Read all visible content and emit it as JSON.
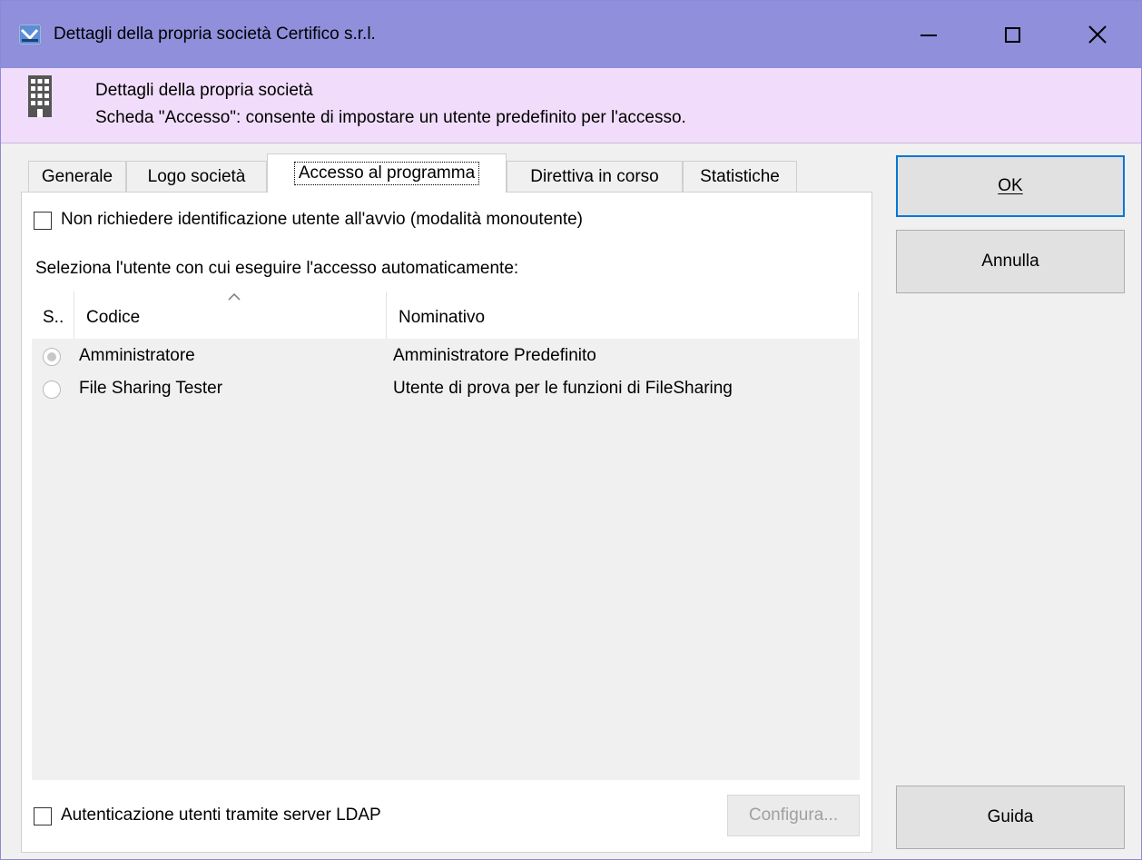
{
  "window": {
    "title": "Dettagli della propria società Certifico s.r.l.",
    "min_icon": "minimize-icon",
    "max_icon": "maximize-icon",
    "close_glyph": "✕"
  },
  "banner": {
    "title": "Dettagli della propria società",
    "description": "Scheda \"Accesso\": consente di impostare un utente predefinito per l'accesso.",
    "icon": "building-icon"
  },
  "tabs": [
    {
      "label": "Generale",
      "active": false
    },
    {
      "label": "Logo società",
      "active": false
    },
    {
      "label": "Accesso al programma",
      "active": true
    },
    {
      "label": "Direttiva in corso",
      "active": false
    },
    {
      "label": "Statistiche",
      "active": false
    }
  ],
  "access": {
    "single_user_label": "Non richiedere identificazione utente all'avvio (modalità monoutente)",
    "single_user_checked": false,
    "select_user_label": "Seleziona l'utente con cui eseguire l'accesso automaticamente:",
    "columns": [
      "S..",
      "Codice",
      "Nominativo"
    ],
    "sort_column": "Codice",
    "users": [
      {
        "code": "Amministratore",
        "name": "Amministratore Predefinito",
        "selected": true
      },
      {
        "code": "File Sharing Tester",
        "name": "Utente di prova per le funzioni di FileSharing",
        "selected": false
      }
    ],
    "ldap_label": "Autenticazione utenti tramite server LDAP",
    "ldap_checked": false,
    "configure_label": "Configura..."
  },
  "buttons": {
    "ok_label": "OK",
    "cancel_label": "Annulla",
    "help_label": "Guida"
  },
  "colors": {
    "titlebar": "#8f8fdc",
    "banner": "#f1ddfb",
    "focus": "#0078d7"
  }
}
